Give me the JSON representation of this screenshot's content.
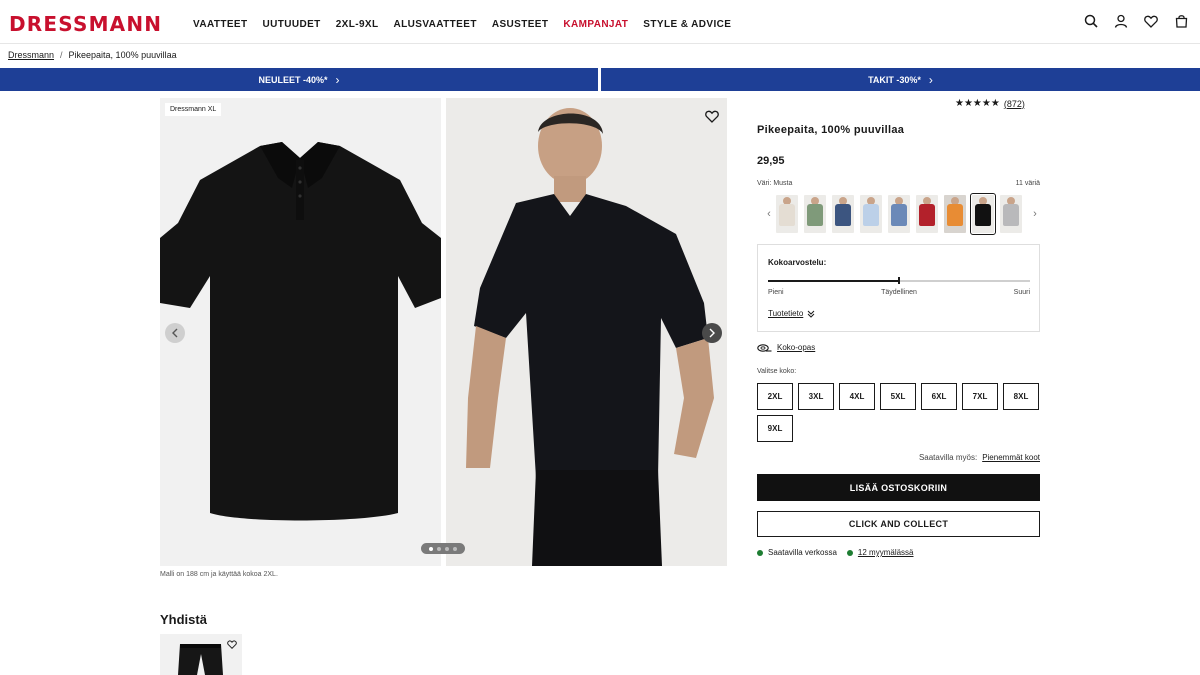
{
  "header": {
    "logo": "DRESSMANN",
    "nav": [
      {
        "label": "VAATTEET",
        "sale": false
      },
      {
        "label": "UUTUUDET",
        "sale": false
      },
      {
        "label": "2XL-9XL",
        "sale": false
      },
      {
        "label": "ALUSVAATTEET",
        "sale": false
      },
      {
        "label": "ASUSTEET",
        "sale": false
      },
      {
        "label": "KAMPANJAT",
        "sale": true
      },
      {
        "label": "STYLE & ADVICE",
        "sale": false
      }
    ],
    "icons": [
      "search-icon",
      "account-icon",
      "wishlist-icon",
      "cart-icon"
    ],
    "brand_color": "#c8102e"
  },
  "breadcrumb": {
    "home": "Dressmann",
    "separator": "/",
    "current": "Pikeepaita, 100% puuvillaa"
  },
  "promos": {
    "left": "NEULEET -40%*",
    "right": "TAKIT -30%*",
    "color": "#1e3f96"
  },
  "gallery": {
    "brand_tag": "Dressmann XL",
    "model_note": "Malli on 188 cm ja käyttää kokoa 2XL.",
    "dots_total": 4,
    "dots_active": 0
  },
  "product": {
    "rating_stars": "★★★★★",
    "rating_count": "(872)",
    "title": "Pikeepaita, 100% puuvillaa",
    "price": "29,95",
    "color_label": "Väri: Musta",
    "color_count": "11 väriä",
    "swatches": [
      {
        "name": "beige",
        "color": "#e4ddd3",
        "selected": false
      },
      {
        "name": "green",
        "color": "#7f9a7a",
        "selected": false
      },
      {
        "name": "navy",
        "color": "#3c5580",
        "selected": false
      },
      {
        "name": "light-blue",
        "color": "#bcd0e8",
        "selected": false
      },
      {
        "name": "blue",
        "color": "#6b89b8",
        "selected": false
      },
      {
        "name": "red",
        "color": "#b3212b",
        "selected": false
      },
      {
        "name": "orange",
        "color": "#e88c34",
        "selected": false
      },
      {
        "name": "black",
        "color": "#111111",
        "selected": true
      },
      {
        "name": "grey",
        "color": "#b9b9bb",
        "selected": false
      }
    ],
    "fit": {
      "title": "Kokoarvostelu:",
      "value": 0.5,
      "labels": [
        "Pieni",
        "Täydellinen",
        "Suuri"
      ],
      "product_info": "Tuotetieto"
    },
    "size_guide": "Koko-opas",
    "select_size": "Valitse koko:",
    "sizes": [
      "2XL",
      "3XL",
      "4XL",
      "5XL",
      "6XL",
      "7XL",
      "8XL",
      "9XL"
    ],
    "also_available_label": "Saatavilla myös:",
    "also_available_link": "Pienemmät koot",
    "add_to_cart": "LISÄÄ OSTOSKORIIN",
    "click_collect": "CLICK AND COLLECT",
    "stock_online": "Saatavilla verkossa",
    "stock_stores": "12 myymälässä"
  },
  "combine": {
    "title": "Yhdistä"
  }
}
